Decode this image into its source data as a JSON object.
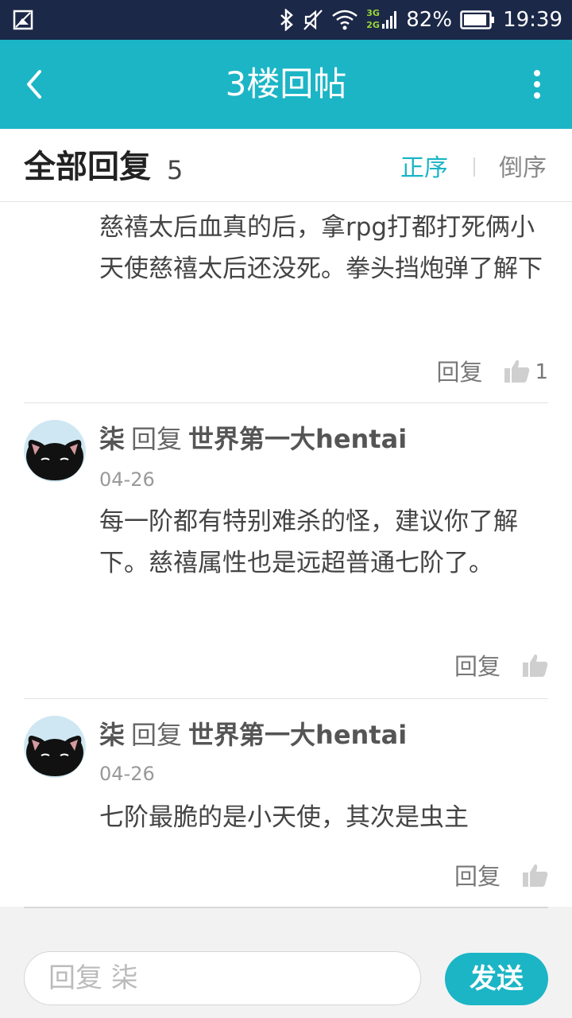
{
  "status_bar": {
    "net_top": "3G",
    "net_bottom": "2G",
    "battery": "82%",
    "time": "19:39"
  },
  "appbar": {
    "title": "3楼回帖"
  },
  "replies_header": {
    "title": "全部回复",
    "count": "5",
    "sort_asc": "正序",
    "sort_desc": "倒序"
  },
  "replies": [
    {
      "text": "慈禧太后血真的后，拿rpg打都打死俩小天使慈禧太后还没死。拳头挡炮弹了解下",
      "reply_label": "回复",
      "likes": "1"
    },
    {
      "author": "柒",
      "reply_word": "回复",
      "target": "世界第一大hentai",
      "date": "04-26",
      "text": "每一阶都有特别难杀的怪，建议你了解下。慈禧属性也是远超普通七阶了。",
      "reply_label": "回复"
    },
    {
      "author": "柒",
      "reply_word": "回复",
      "target": "世界第一大hentai",
      "date": "04-26",
      "text": "七阶最脆的是小天使，其次是虫主",
      "reply_label": "回复"
    }
  ],
  "composer": {
    "placeholder": "回复 柒",
    "send_label": "发送"
  },
  "colors": {
    "accent": "#1bb5c6",
    "status_bar": "#1c2847"
  },
  "icons": [
    "image-notification-icon",
    "bluetooth-icon",
    "mute-icon",
    "wifi-icon",
    "signal-icon",
    "battery-icon",
    "back-arrow-icon",
    "more-vert-icon",
    "thumbs-up-icon",
    "avatar-icon"
  ]
}
